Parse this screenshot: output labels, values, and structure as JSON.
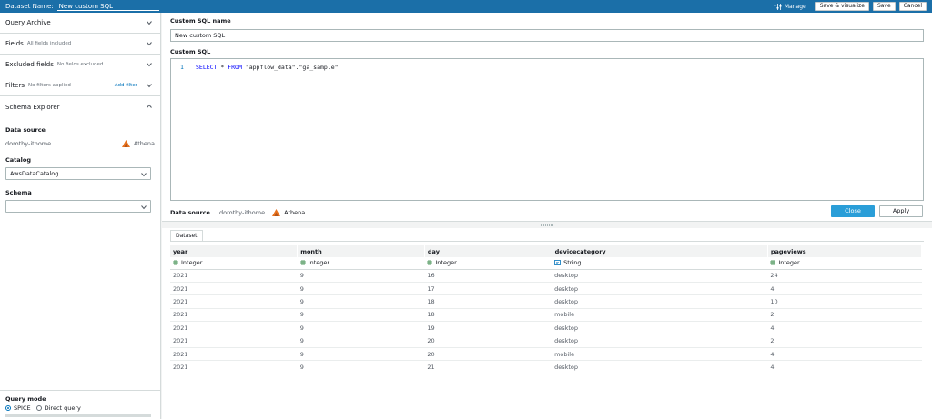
{
  "header": {
    "dataset_name_label": "Dataset Name:",
    "dataset_name_value": "New custom SQL",
    "manage_label": "Manage",
    "save_visualize_label": "Save & visualize",
    "save_label": "Save",
    "cancel_label": "Cancel"
  },
  "sidebar": {
    "query_archive": "Query Archive",
    "fields": {
      "title": "Fields",
      "sub": "All fields included"
    },
    "excluded": {
      "title": "Excluded fields",
      "sub": "No fields excluded"
    },
    "filters": {
      "title": "Filters",
      "sub": "No filters applied",
      "add": "Add filter"
    },
    "schema_explorer": "Schema Explorer",
    "data_source_label": "Data source",
    "data_source_value": "dorothy-ithome",
    "engine": "Athena",
    "catalog_label": "Catalog",
    "catalog_value": "AwsDataCatalog",
    "schema_label": "Schema",
    "schema_value": "",
    "query_mode_label": "Query mode",
    "mode_spice": "SPICE",
    "mode_direct": "Direct query"
  },
  "editor": {
    "name_label": "Custom SQL name",
    "name_value": "New custom SQL",
    "sql_label": "Custom SQL",
    "line_number": "1",
    "sql_select": "SELECT",
    "sql_star": " * ",
    "sql_from": "FROM",
    "sql_rest": " \"appflow_data\".\"ga_sample\"",
    "data_source_label": "Data source",
    "data_source_value": "dorothy-ithome",
    "engine": "Athena",
    "close_label": "Close",
    "apply_label": "Apply"
  },
  "preview": {
    "tab_label": "Dataset",
    "columns": [
      "year",
      "month",
      "day",
      "devicecategory",
      "pageviews"
    ],
    "types": [
      "Integer",
      "Integer",
      "Integer",
      "String",
      "Integer"
    ],
    "rows": [
      [
        "2021",
        "9",
        "16",
        "desktop",
        "24"
      ],
      [
        "2021",
        "9",
        "17",
        "desktop",
        "4"
      ],
      [
        "2021",
        "9",
        "18",
        "desktop",
        "10"
      ],
      [
        "2021",
        "9",
        "18",
        "mobile",
        "2"
      ],
      [
        "2021",
        "9",
        "19",
        "desktop",
        "4"
      ],
      [
        "2021",
        "9",
        "20",
        "desktop",
        "2"
      ],
      [
        "2021",
        "9",
        "20",
        "mobile",
        "4"
      ],
      [
        "2021",
        "9",
        "21",
        "desktop",
        "4"
      ]
    ]
  },
  "colors": {
    "topbar": "#1b6fa8",
    "primary_button": "#2a9ed8",
    "link": "#0073bb",
    "athena": "#e8731f"
  }
}
